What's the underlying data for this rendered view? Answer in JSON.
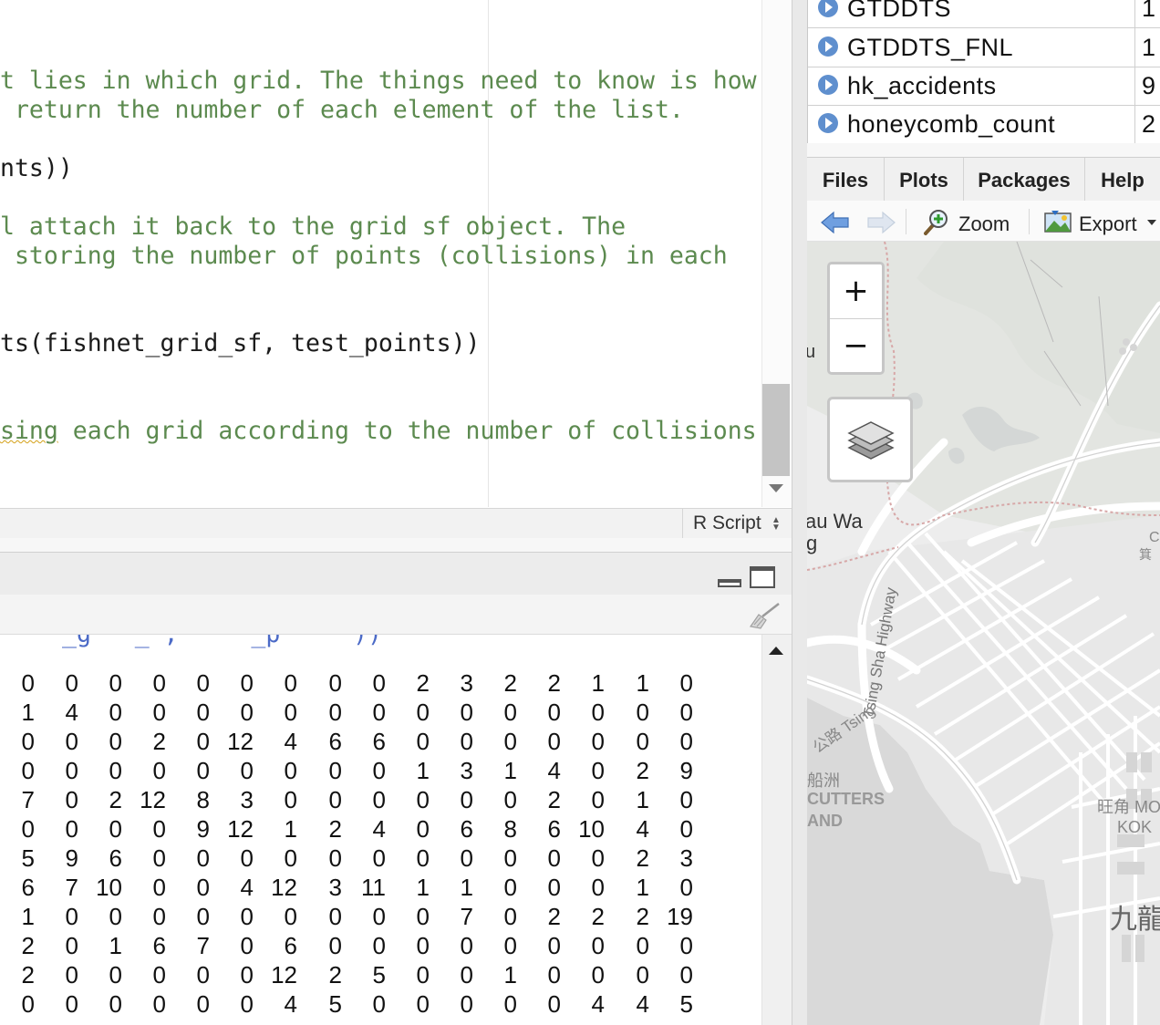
{
  "editor": {
    "lines": [
      {
        "text": "t lies in which grid. The things need to know is how",
        "kind": "comment"
      },
      {
        "text": " return the number of each element of the list.",
        "kind": "comment"
      },
      {
        "text": "nts))",
        "kind": "code"
      },
      {
        "text": "l attach it back to the grid sf object. The",
        "kind": "comment"
      },
      {
        "text": " storing the number of points (collisions) in each",
        "kind": "comment"
      },
      {
        "text": "ts(fishnet_grid_sf, test_points))",
        "kind": "code"
      },
      {
        "text": "sing each grid according to the number of collisions",
        "kind": "comment"
      }
    ],
    "file_type": "R Script"
  },
  "console": {
    "cut_line": "_g   _ ,     _p     ))",
    "rows": [
      [
        0,
        0,
        0,
        0,
        0,
        0,
        0,
        0,
        0,
        2,
        3,
        2,
        2,
        1,
        1,
        0
      ],
      [
        1,
        4,
        0,
        0,
        0,
        0,
        0,
        0,
        0,
        0,
        0,
        0,
        0,
        0,
        0,
        0
      ],
      [
        0,
        0,
        0,
        2,
        0,
        12,
        4,
        6,
        6,
        0,
        0,
        0,
        0,
        0,
        0,
        0
      ],
      [
        0,
        0,
        0,
        0,
        0,
        0,
        0,
        0,
        0,
        1,
        3,
        1,
        4,
        0,
        2,
        9
      ],
      [
        7,
        0,
        2,
        12,
        8,
        3,
        0,
        0,
        0,
        0,
        0,
        0,
        2,
        0,
        1,
        0
      ],
      [
        0,
        0,
        0,
        0,
        9,
        12,
        1,
        2,
        4,
        0,
        6,
        8,
        6,
        10,
        4,
        0
      ],
      [
        5,
        9,
        6,
        0,
        0,
        0,
        0,
        0,
        0,
        0,
        0,
        0,
        0,
        0,
        2,
        3
      ],
      [
        6,
        7,
        10,
        0,
        0,
        4,
        12,
        3,
        11,
        1,
        1,
        0,
        0,
        0,
        1,
        0
      ],
      [
        1,
        0,
        0,
        0,
        0,
        0,
        0,
        0,
        0,
        0,
        7,
        0,
        2,
        2,
        2,
        19
      ],
      [
        2,
        0,
        1,
        6,
        7,
        0,
        6,
        0,
        0,
        0,
        0,
        0,
        0,
        0,
        0,
        0
      ],
      [
        2,
        0,
        0,
        0,
        0,
        0,
        12,
        2,
        5,
        0,
        0,
        1,
        0,
        0,
        0,
        0
      ],
      [
        0,
        0,
        0,
        0,
        0,
        0,
        4,
        5,
        0,
        0,
        0,
        0,
        0,
        4,
        4,
        5
      ]
    ]
  },
  "environment": {
    "rows": [
      {
        "name": "GTDDTS",
        "value": "1"
      },
      {
        "name": "GTDDTS_FNL",
        "value": "1"
      },
      {
        "name": "hk_accidents",
        "value": "9"
      },
      {
        "name": "honeycomb_count",
        "value": "2"
      }
    ]
  },
  "files_pane": {
    "tabs": [
      "Files",
      "Plots",
      "Packages",
      "Help"
    ],
    "zoom_label": "Zoom",
    "export_label": "Export"
  },
  "map": {
    "zoom_in": "+",
    "zoom_out": "−",
    "labels": {
      "lau_wa": "au Wa",
      "g": "g",
      "u": "u",
      "highway": "Tsing Sha Highway",
      "tsing": "公路 Tsing",
      "chuen": "船洲",
      "cutters": "CUTTERS",
      "island": "AND",
      "wong": "旺角 MO",
      "kok": "KOK",
      "kowloon": "九龍",
      "c": "C",
      "chi": "箕"
    }
  },
  "icons": {
    "back": "arrow-left-icon",
    "forward": "arrow-right-icon",
    "zoom": "magnifier-plus-icon",
    "export": "export-image-icon",
    "layers": "layers-icon",
    "broom": "broom-icon",
    "play": "play-circle-icon"
  },
  "colors": {
    "comment": "#5c8a4f",
    "code": "#1b1b1b",
    "console_input": "#4b6ac7",
    "env_icon": "#5f8fce",
    "map_bg": "#ededed",
    "road": "#ffffff",
    "water": "#d9d9d9"
  }
}
